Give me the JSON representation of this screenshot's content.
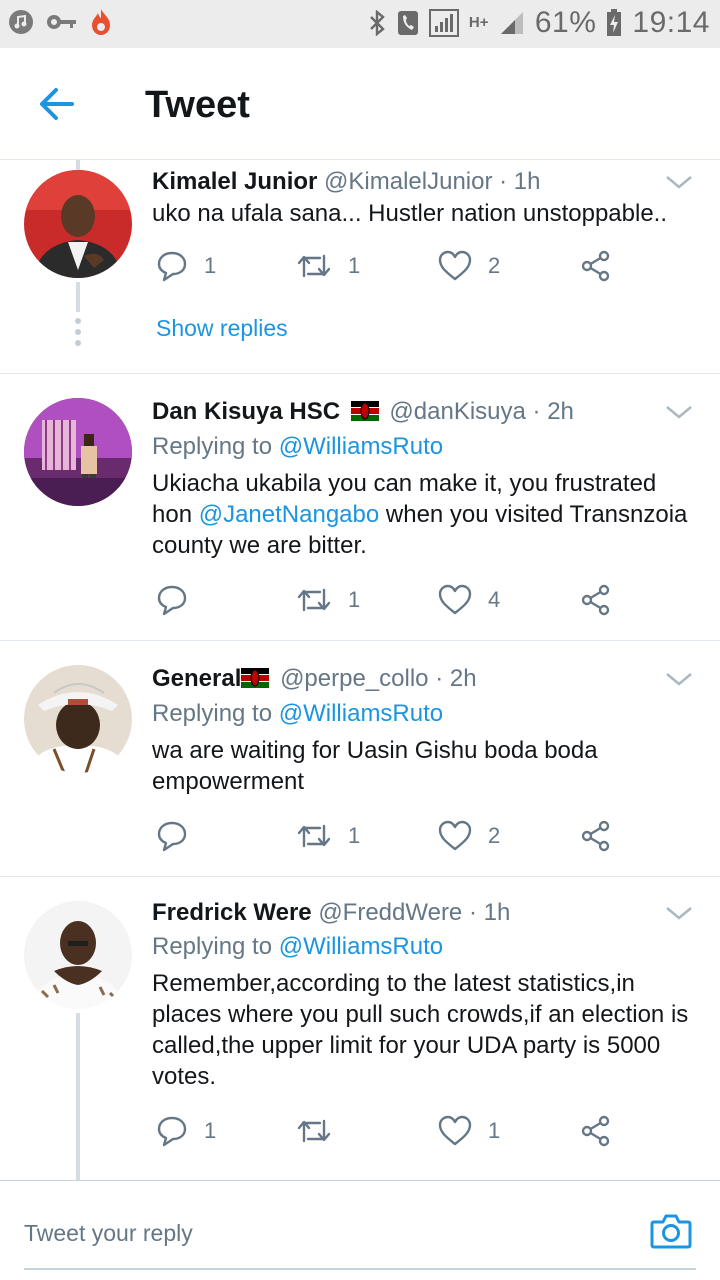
{
  "status_bar": {
    "battery": "61%",
    "time": "19:14",
    "network": "H+"
  },
  "header": {
    "title": "Tweet"
  },
  "tweets": [
    {
      "name": "Kimalel Junior",
      "handle": "@KimalelJunior",
      "time": "· 1h",
      "reply_prefix": "",
      "reply_to": "",
      "body": "uko na ufala sana... Hustler nation unstoppable..",
      "replies": "1",
      "retweets": "1",
      "likes": "2",
      "show_replies": "Show replies"
    },
    {
      "name": "Dan Kisuya HSC",
      "handle": "@danKisuya",
      "time": "· 2h",
      "reply_prefix": "Replying to",
      "reply_to": "@WilliamsRuto",
      "body_before": "Ukiacha ukabila you can make it, you frustrated hon ",
      "body_mention": "@JanetNangabo",
      "body_after": " when you visited Transnzoia county we are bitter.",
      "replies": "",
      "retweets": "1",
      "likes": "4"
    },
    {
      "name": "General",
      "handle": "@perpe_collo",
      "time": "· 2h",
      "reply_prefix": "Replying to",
      "reply_to": "@WilliamsRuto",
      "body": "wa are waiting for Uasin Gishu boda boda empowerment",
      "replies": "",
      "retweets": "1",
      "likes": "2"
    },
    {
      "name": "Fredrick Were",
      "handle": "@FreddWere",
      "time": "· 1h",
      "reply_prefix": "Replying to",
      "reply_to": "@WilliamsRuto",
      "body": "Remember,according to the latest statistics,in places where you pull such crowds,if an election is called,the upper limit for your UDA party is 5000 votes.",
      "replies": "1",
      "retweets": "",
      "likes": "1"
    }
  ],
  "composer": {
    "placeholder": "Tweet your reply"
  },
  "colors": {
    "accent": "#1b95e0",
    "muted": "#657786",
    "text": "#14171a",
    "divider": "#e1e8ed"
  }
}
